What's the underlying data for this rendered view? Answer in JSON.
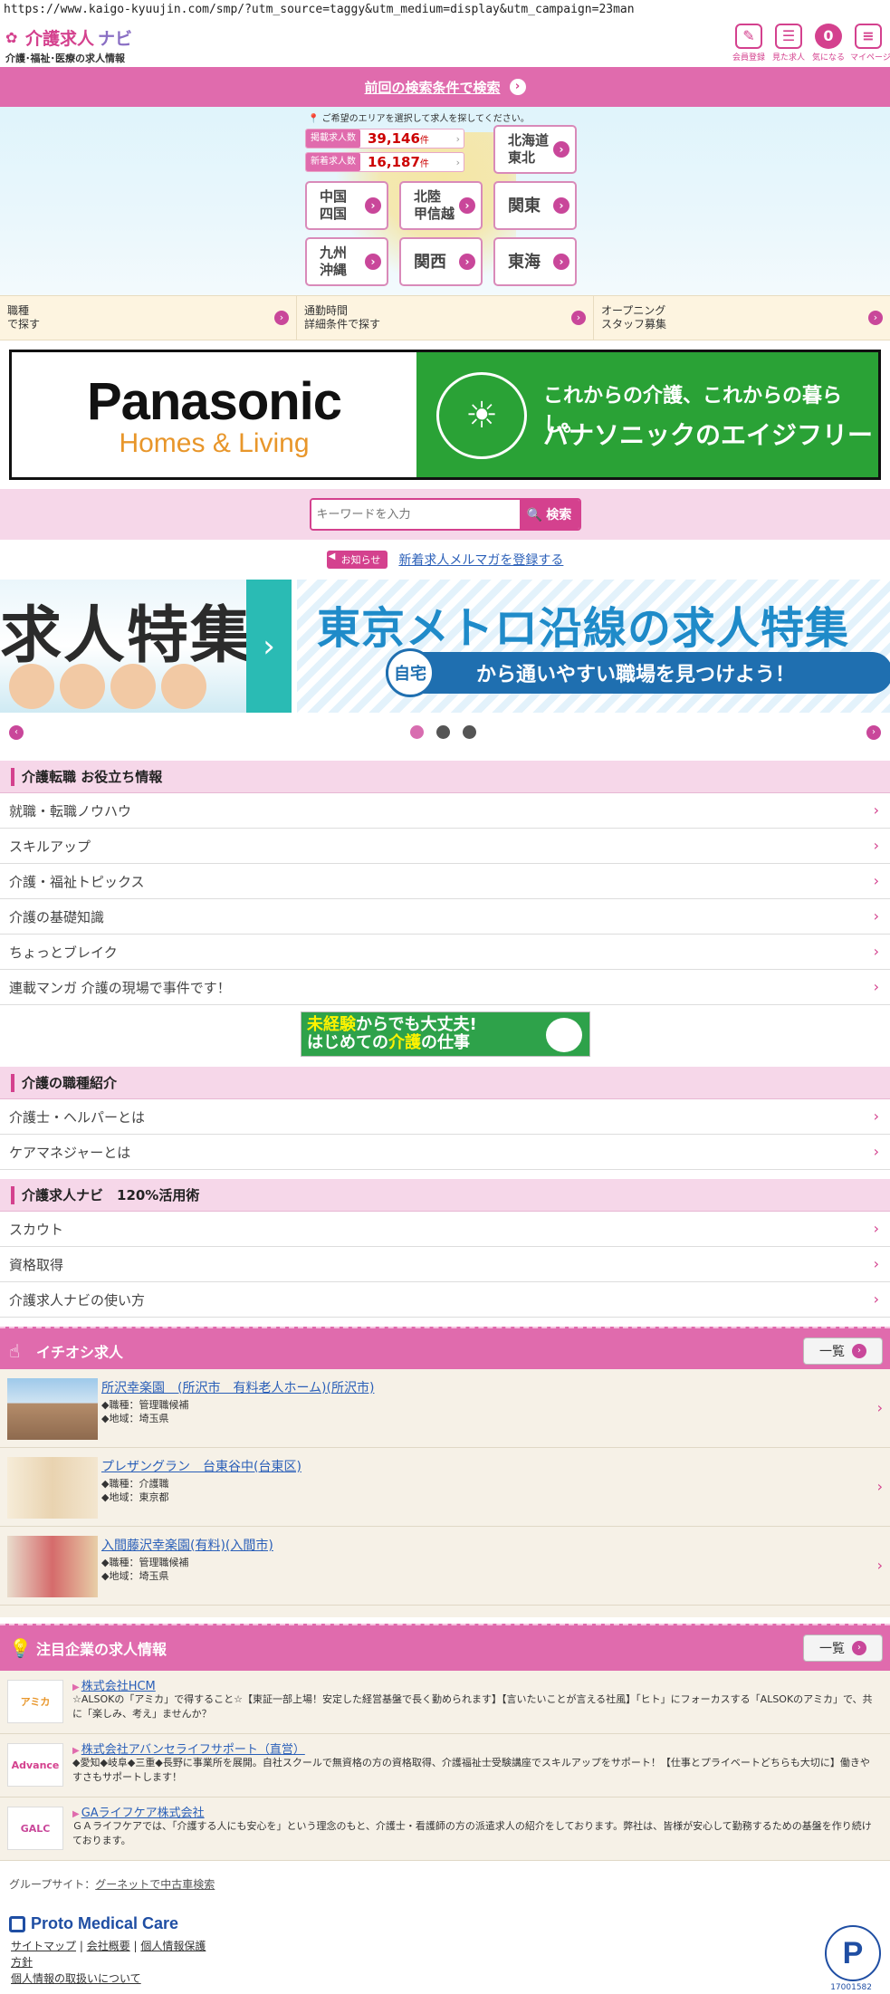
{
  "url": "https://www.kaigo-kyuujin.com/smp/?utm_source=taggy&utm_medium=display&utm_campaign=23man",
  "header": {
    "logo_main": "介護求人",
    "logo_nav": "ナビ",
    "logo_sub": "介護･福祉･医療の求人情報",
    "icons": [
      {
        "label": "会員登録",
        "icon": "pencil-icon"
      },
      {
        "label": "見た求人",
        "icon": "history-icon"
      },
      {
        "label": "気になる",
        "icon": "heart-icon",
        "badge": "0"
      },
      {
        "label": "マイページ",
        "icon": "mypage-icon"
      }
    ]
  },
  "prev_search": "前回の検索条件で検索",
  "area": {
    "hint": "ご希望のエリアを選択して求人を探してください。",
    "total_label": "掲載求人数",
    "total_value": "39,146",
    "new_label": "新着求人数",
    "new_value": "16,187",
    "unit": "件",
    "regions": [
      "北海道\n東北",
      "中国\n四国",
      "北陸\n甲信越",
      "関東",
      "九州\n沖縄",
      "関西",
      "東海"
    ]
  },
  "sub_search": [
    {
      "l1": "職種",
      "l2": "で探す"
    },
    {
      "l1": "通勤時間",
      "l2": "詳細条件で探す"
    },
    {
      "l1": "オープニング",
      "l2": "スタッフ募集"
    }
  ],
  "ad": {
    "brand": "Panasonic",
    "brand_sub": "Homes & Living",
    "copy1": "これからの介護、これからの暮らし。",
    "copy2": "パナソニックのエイジフリー"
  },
  "keyword": {
    "placeholder": "キーワードを入力",
    "button": "検索"
  },
  "notice": {
    "tag": "お知らせ",
    "link": "新着求人メルマガを登録する"
  },
  "carousel": {
    "slide_a": "求人特集",
    "slide_b_title": "東京メトロ沿線の求人特集",
    "slide_b_home": "自宅",
    "slide_b_sub": "から通いやすい職場を見つけよう！"
  },
  "sections": {
    "tips": {
      "title": "介護転職 お役立ち情報",
      "items": [
        "就職・転職ノウハウ",
        "スキルアップ",
        "介護・福祉トピックス",
        "介護の基礎知識",
        "ちょっとブレイク",
        "連載マンガ 介護の現場で事件です！"
      ]
    },
    "mini_banner": {
      "l1a": "未経験",
      "l1b": "からでも大丈夫!",
      "l2a": "はじめての",
      "l2b": "介護",
      "l2c": "の仕事"
    },
    "jobs_intro": {
      "title": "介護の職種紹介",
      "items": [
        "介護士・ヘルパーとは",
        "ケアマネジャーとは"
      ]
    },
    "use": {
      "title": "介護求人ナビ　120%活用術",
      "items": [
        "スカウト",
        "資格取得",
        "介護求人ナビの使い方"
      ]
    }
  },
  "recommend": {
    "title": "イチオシ求人",
    "all": "一覧",
    "jobs": [
      {
        "title": "所沢幸楽園　(所沢市　有料老人ホーム)(所沢市)",
        "job": "◆職種：管理職候補",
        "area": "◆地域：埼玉県"
      },
      {
        "title": "プレザングラン　台東谷中(台東区)",
        "job": "◆職種：介護職",
        "area": "◆地域：東京都"
      },
      {
        "title": "入間藤沢幸楽園(有料)(入間市)",
        "job": "◆職種：管理職候補",
        "area": "◆地域：埼玉県"
      }
    ]
  },
  "companies": {
    "title": "注目企業の求人情報",
    "all": "一覧",
    "items": [
      {
        "logo": "アミカ",
        "name": "株式会社HCM",
        "desc": "☆ALSOKの「アミカ」で得すること☆【東証一部上場！安定した経営基盤で長く勤められます】【言いたいことが言える社風】「ヒト」にフォーカスする「ALSOKのアミカ」で、共に「楽しみ、考え」ませんか？"
      },
      {
        "logo": "Advance",
        "name": "株式会社アバンセライフサポート（直営）",
        "desc": "◆愛知◆岐阜◆三重◆長野に事業所を展開。自社スクールで無資格の方の資格取得、介護福祉士受験講座でスキルアップをサポート！【仕事とプライベートどちらも大切に】働きやすさもサポートします！"
      },
      {
        "logo": "GALC",
        "name": "GAライフケア株式会社",
        "desc": "ＧＡライフケアでは、「介護する人にも安心を」という理念のもと、介護士・看護師の方の派遣求人の紹介をしております。弊社は、皆様が安心して勤務するための基盤を作り続けております。"
      }
    ]
  },
  "footer": {
    "group_label": "グループサイト：",
    "group_link": "グーネットで中古車検索",
    "brand": "Proto Medical Care",
    "links": [
      "サイトマップ",
      "会社概要",
      "個人情報保護",
      "方針",
      "個人情報の取扱いについて"
    ],
    "pmark_num": "17001582"
  }
}
